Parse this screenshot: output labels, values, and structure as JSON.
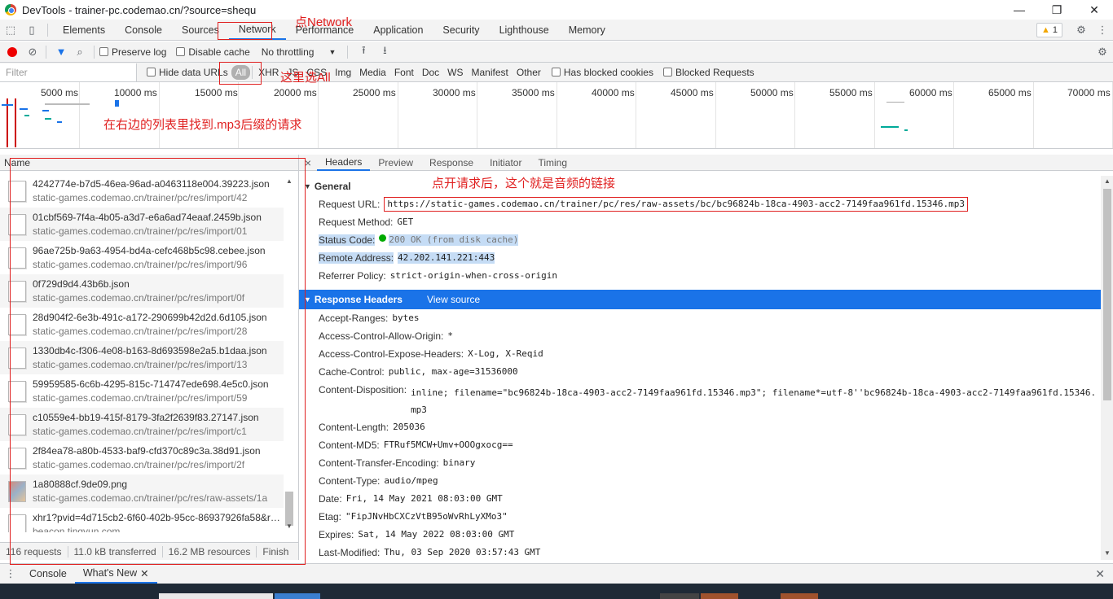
{
  "window": {
    "title": "DevTools - trainer-pc.codemao.cn/?source=shequ",
    "minimize": "—",
    "restore": "❐",
    "close": "✕"
  },
  "main_tabs": [
    "Elements",
    "Console",
    "Sources",
    "Network",
    "Performance",
    "Application",
    "Security",
    "Lighthouse",
    "Memory"
  ],
  "active_main_tab": "Network",
  "warning_count": "1",
  "toolbar": {
    "preserve_log": "Preserve log",
    "disable_cache": "Disable cache",
    "throttling": "No throttling"
  },
  "filterbar": {
    "filter_placeholder": "Filter",
    "hide_data_urls": "Hide data URLs",
    "types": [
      "All",
      "XHR",
      "JS",
      "CSS",
      "Img",
      "Media",
      "Font",
      "Doc",
      "WS",
      "Manifest",
      "Other"
    ],
    "active_type": "All",
    "has_blocked_cookies": "Has blocked cookies",
    "blocked_requests": "Blocked Requests"
  },
  "timeline": {
    "ticks": [
      "5000 ms",
      "10000 ms",
      "15000 ms",
      "20000 ms",
      "25000 ms",
      "30000 ms",
      "35000 ms",
      "40000 ms",
      "45000 ms",
      "50000 ms",
      "55000 ms",
      "60000 ms",
      "65000 ms",
      "70000 ms"
    ]
  },
  "request_list": {
    "header": "Name",
    "rows": [
      {
        "name": "4242774e-b7d5-46ea-96ad-a0463118e004.39223.json",
        "domain": "static-games.codemao.cn/trainer/pc/res/import/42",
        "icon": "file-icon"
      },
      {
        "name": "01cbf569-7f4a-4b05-a3d7-e6a6ad74eaaf.2459b.json",
        "domain": "static-games.codemao.cn/trainer/pc/res/import/01",
        "icon": "file-icon"
      },
      {
        "name": "96ae725b-9a63-4954-bd4a-cefc468b5c98.cebee.json",
        "domain": "static-games.codemao.cn/trainer/pc/res/import/96",
        "icon": "file-icon"
      },
      {
        "name": "0f729d9d4.43b6b.json",
        "domain": "static-games.codemao.cn/trainer/pc/res/import/0f",
        "icon": "file-icon"
      },
      {
        "name": "28d904f2-6e3b-491c-a172-290699b42d2d.6d105.json",
        "domain": "static-games.codemao.cn/trainer/pc/res/import/28",
        "icon": "file-icon"
      },
      {
        "name": "1330db4c-f306-4e08-b163-8d693598e2a5.b1daa.json",
        "domain": "static-games.codemao.cn/trainer/pc/res/import/13",
        "icon": "file-icon"
      },
      {
        "name": "59959585-6c6b-4295-815c-714747ede698.4e5c0.json",
        "domain": "static-games.codemao.cn/trainer/pc/res/import/59",
        "icon": "file-icon"
      },
      {
        "name": "c10559e4-bb19-415f-8179-3fa2f2639f83.27147.json",
        "domain": "static-games.codemao.cn/trainer/pc/res/import/c1",
        "icon": "file-icon"
      },
      {
        "name": "2f84ea78-a80b-4533-baf9-cfd370c89c3a.38d91.json",
        "domain": "static-games.codemao.cn/trainer/pc/res/import/2f",
        "icon": "file-icon"
      },
      {
        "name": "1a80888cf.9de09.png",
        "domain": "static-games.codemao.cn/trainer/pc/res/raw-assets/1a",
        "icon": "image-icon"
      },
      {
        "name": "xhr1?pvid=4d715cb2-6f60-402b-95cc-86937926fa58&ref...",
        "domain": "beacon.tingyun.com",
        "icon": "file-icon"
      }
    ],
    "footer": [
      "116 requests",
      "11.0 kB transferred",
      "16.2 MB resources",
      "Finish"
    ]
  },
  "details": {
    "tabs": [
      "Headers",
      "Preview",
      "Response",
      "Initiator",
      "Timing"
    ],
    "active_tab": "Headers",
    "general_title": "General",
    "general": [
      {
        "key": "Request URL:",
        "value": "https://static-games.codemao.cn/trainer/pc/res/raw-assets/bc/bc96824b-18ca-4903-acc2-7149faa961fd.15346.mp3"
      },
      {
        "key": "Request Method:",
        "value": "GET"
      },
      {
        "key": "Status Code:",
        "value": "200 OK (from disk cache)"
      },
      {
        "key": "Remote Address:",
        "value": "42.202.141.221:443"
      },
      {
        "key": "Referrer Policy:",
        "value": "strict-origin-when-cross-origin"
      }
    ],
    "response_headers_title": "Response Headers",
    "view_source": "View source",
    "response_headers": [
      {
        "key": "Accept-Ranges:",
        "value": "bytes"
      },
      {
        "key": "Access-Control-Allow-Origin:",
        "value": "*"
      },
      {
        "key": "Access-Control-Expose-Headers:",
        "value": "X-Log, X-Reqid"
      },
      {
        "key": "Cache-Control:",
        "value": "public, max-age=31536000"
      },
      {
        "key": "Content-Disposition:",
        "value": "inline; filename=\"bc96824b-18ca-4903-acc2-7149faa961fd.15346.mp3\"; filename*=utf-8''bc96824b-18ca-4903-acc2-7149faa961fd.15346.mp3"
      },
      {
        "key": "Content-Length:",
        "value": "205036"
      },
      {
        "key": "Content-MD5:",
        "value": "FTRuf5MCW+Umv+OOOgxocg=="
      },
      {
        "key": "Content-Transfer-Encoding:",
        "value": "binary"
      },
      {
        "key": "Content-Type:",
        "value": "audio/mpeg"
      },
      {
        "key": "Date:",
        "value": "Fri, 14 May 2021 08:03:00 GMT"
      },
      {
        "key": "Etag:",
        "value": "\"FipJNvHbCXCzVtB95oWvRhLyXMo3\""
      },
      {
        "key": "Expires:",
        "value": "Sat, 14 May 2022 08:03:00 GMT"
      },
      {
        "key": "Last-Modified:",
        "value": "Thu, 03 Sep 2020 03:57:43 GMT"
      }
    ]
  },
  "drawer": {
    "tabs": [
      "Console",
      "What's New"
    ],
    "active_tab": "What's New",
    "close": "✕"
  },
  "annotations": {
    "click_network": "点Network",
    "select_all": "这里选All",
    "find_mp3": "在右边的列表里找到.mp3后缀的请求",
    "audio_link": "点开请求后，这个就是音频的链接"
  },
  "colors": {
    "accent": "#1a73e8",
    "annotation": "#e02020",
    "record": "#ee0000",
    "status_ok": "#00aa00"
  }
}
